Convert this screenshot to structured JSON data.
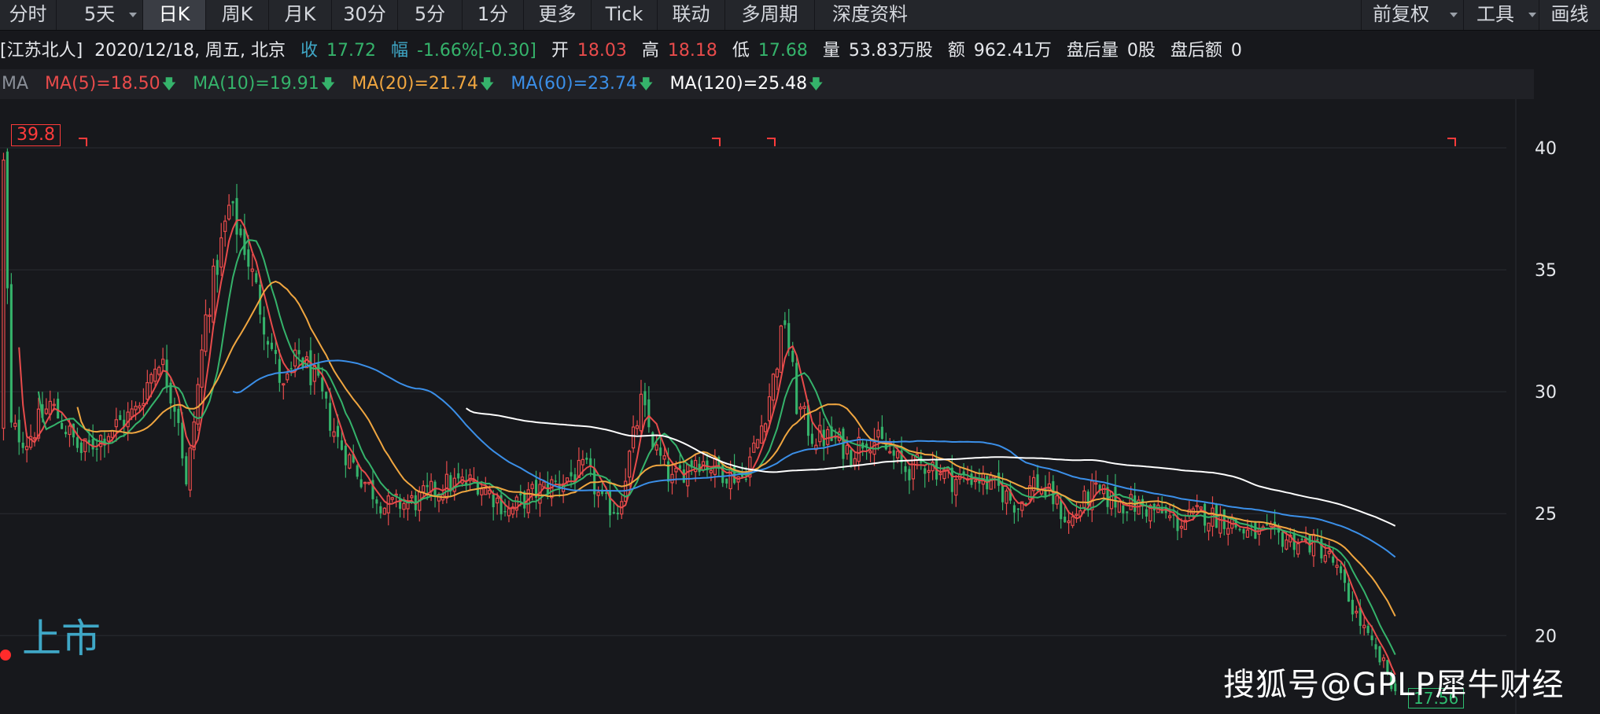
{
  "toolbar": {
    "tabs": [
      "分时",
      "5天",
      "日K",
      "周K",
      "月K",
      "30分",
      "5分",
      "1分",
      "更多",
      "Tick",
      "联动",
      "多周期",
      "深度资料"
    ],
    "active_tab": "日K",
    "right_items": [
      "前复权",
      "工具",
      "画线"
    ]
  },
  "info": {
    "name": "[江苏北人]",
    "date": "2020/12/18, 周五, 北京",
    "close_label": "收",
    "close": "17.72",
    "change_label": "幅",
    "change_pct": "-1.66%",
    "change_abs": "[-0.30]",
    "open_label": "开",
    "open": "18.03",
    "high_label": "高",
    "high": "18.18",
    "low_label": "低",
    "low": "17.68",
    "volume_label": "量",
    "volume": "53.83万股",
    "amount_label": "额",
    "amount": "962.41万",
    "after_volume_label": "盘后量",
    "after_volume": "0股",
    "after_amount_label": "盘后额",
    "after_amount": "0"
  },
  "ma_legend": {
    "label": "MA",
    "items": [
      {
        "text": "MA(5)=18.50",
        "color": "#e84b4b"
      },
      {
        "text": "MA(10)=19.91",
        "color": "#35b36b"
      },
      {
        "text": "MA(20)=21.74",
        "color": "#f0a640"
      },
      {
        "text": "MA(60)=23.74",
        "color": "#3b8fe8"
      },
      {
        "text": "MA(120)=25.48",
        "color": "#ffffff"
      }
    ],
    "arrow_color": "#35b36b"
  },
  "colors": {
    "up": "#e84b4b",
    "down": "#35b36b",
    "grid": "#2a2c32",
    "axis_text": "#e6e8ec"
  },
  "annotations": {
    "max_price": "39.8",
    "min_price": "17.56",
    "listing": "上市",
    "watermark": "搜狐号@GPLP犀牛财经"
  },
  "chart_data": {
    "type": "candlestick",
    "title": "",
    "y_ticks": [
      40,
      35,
      30,
      25,
      20
    ],
    "ylim": [
      17.3,
      42.0
    ],
    "bars": 380,
    "anchors": [
      [
        0,
        39.5
      ],
      [
        2,
        28.5
      ],
      [
        6,
        28.0
      ],
      [
        12,
        29.5
      ],
      [
        20,
        27.5
      ],
      [
        28,
        28.5
      ],
      [
        34,
        29.2
      ],
      [
        40,
        31.5
      ],
      [
        45,
        29.0
      ],
      [
        47,
        26.0
      ],
      [
        52,
        33.0
      ],
      [
        58,
        37.5
      ],
      [
        62,
        36.0
      ],
      [
        66,
        33.5
      ],
      [
        72,
        30.0
      ],
      [
        76,
        31.5
      ],
      [
        80,
        30.5
      ],
      [
        86,
        28.0
      ],
      [
        92,
        26.5
      ],
      [
        98,
        25.3
      ],
      [
        106,
        25.5
      ],
      [
        114,
        26.2
      ],
      [
        122,
        26.3
      ],
      [
        130,
        25.1
      ],
      [
        136,
        25.8
      ],
      [
        144,
        26.4
      ],
      [
        150,
        26.8
      ],
      [
        154,
        25.4
      ],
      [
        158,
        25.2
      ],
      [
        164,
        29.5
      ],
      [
        168,
        27.5
      ],
      [
        172,
        26.3
      ],
      [
        178,
        27.3
      ],
      [
        184,
        26.8
      ],
      [
        190,
        26.5
      ],
      [
        194,
        28.0
      ],
      [
        198,
        30.5
      ],
      [
        201,
        33.0
      ],
      [
        204,
        29.5
      ],
      [
        208,
        28.2
      ],
      [
        214,
        28.0
      ],
      [
        218,
        27.5
      ],
      [
        222,
        28.2
      ],
      [
        226,
        27.8
      ],
      [
        232,
        26.8
      ],
      [
        238,
        27.1
      ],
      [
        244,
        26.4
      ],
      [
        250,
        26.5
      ],
      [
        256,
        26.0
      ],
      [
        261,
        25.3
      ],
      [
        265,
        26.3
      ],
      [
        270,
        25.6
      ],
      [
        274,
        24.6
      ],
      [
        280,
        25.9
      ],
      [
        286,
        25.5
      ],
      [
        292,
        25.3
      ],
      [
        298,
        25.0
      ],
      [
        302,
        24.6
      ],
      [
        308,
        25.0
      ],
      [
        314,
        24.8
      ],
      [
        320,
        24.2
      ],
      [
        326,
        24.1
      ],
      [
        332,
        23.9
      ],
      [
        338,
        23.7
      ],
      [
        342,
        23.0
      ],
      [
        346,
        21.5
      ],
      [
        350,
        20.2
      ],
      [
        352,
        19.5
      ],
      [
        356,
        18.5
      ],
      [
        358,
        17.7
      ]
    ],
    "series": [
      {
        "name": "MA(5)",
        "values": [
          18.5
        ]
      },
      {
        "name": "MA(10)",
        "values": [
          19.91
        ]
      },
      {
        "name": "MA(20)",
        "values": [
          21.74
        ]
      },
      {
        "name": "MA(60)",
        "values": [
          23.74
        ]
      },
      {
        "name": "MA(120)",
        "values": [
          25.48
        ]
      }
    ]
  }
}
